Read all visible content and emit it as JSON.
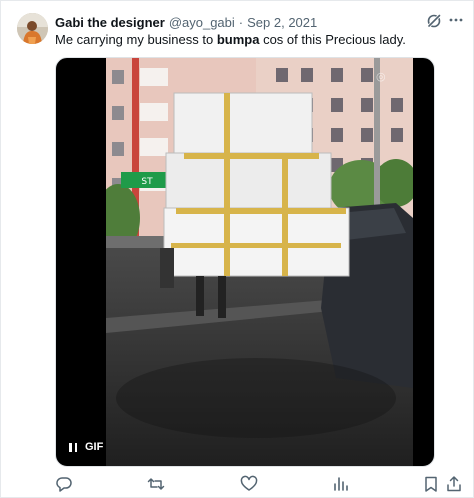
{
  "tweet": {
    "author_name": "Gabi the designer",
    "handle": "@ayo_gabi",
    "separator": "·",
    "date": "Sep 2, 2021",
    "text_before": "Me carrying my business to ",
    "text_bold": "bumpa",
    "text_after": " cos of this Precious lady."
  },
  "media": {
    "badge_label": "GIF",
    "pause_icon": "pause-icon",
    "sign_text": "ST"
  },
  "actions": [
    "reply-icon",
    "retweet-icon",
    "like-icon",
    "views-icon",
    "bookmark-icon",
    "share-icon"
  ],
  "colors": {
    "text": "#0f1419",
    "secondary": "#536471",
    "border": "#e6e9ec",
    "media_bg": "#000000"
  }
}
